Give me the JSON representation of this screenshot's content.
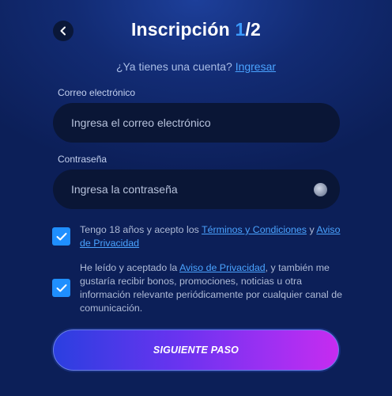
{
  "header": {
    "title_text": "Inscripción ",
    "step_current": "1",
    "step_separator": "/2"
  },
  "login_prompt": {
    "question": "¿Ya tienes una cuenta? ",
    "link": "Ingresar"
  },
  "email": {
    "label": "Correo electrónico",
    "placeholder": "Ingresa el correo electrónico",
    "value": ""
  },
  "password": {
    "label": "Contraseña",
    "placeholder": "Ingresa la contraseña",
    "value": ""
  },
  "consent_age": {
    "checked": true,
    "text_before": "Tengo 18 años y acepto los ",
    "link_terms": "Términos y Condiciones",
    "text_middle": " y ",
    "link_privacy": "Aviso de Privacidad"
  },
  "consent_marketing": {
    "checked": true,
    "text_before": "He leído y aceptado la ",
    "link_privacy": "Aviso de Privacidad",
    "text_after": ", y también me gustaría recibir bonos, promociones, noticias u otra información relevante periódicamente por cualquier canal de comunicación."
  },
  "submit": {
    "label": "SIGUIENTE PASO"
  },
  "colors": {
    "accent": "#3b9bff",
    "link": "#4aa3ff",
    "checkbox": "#1f8fff",
    "input_bg": "#0a1636"
  },
  "icons": {
    "back": "chevron-left-icon",
    "password_toggle": "eye-icon",
    "checkmark": "checkmark-icon"
  }
}
